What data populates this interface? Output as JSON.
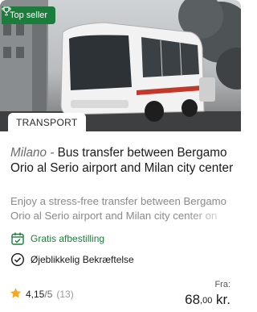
{
  "badge": {
    "label": "Top seller",
    "icon": "trophy-icon"
  },
  "category": "TRANSPORT",
  "listing": {
    "location": "Milano",
    "separator": " - ",
    "title": "Bus transfer between Bergamo Orio al Serio airport and Milan city center",
    "description": "Enjoy a stress-free transfer between Bergamo Orio al Serio airport and Milan city center on"
  },
  "features": [
    {
      "label": "Gratis afbestilling",
      "icon": "calendar-check-icon"
    },
    {
      "label": "Øjeblikkelig Bekræftelse",
      "icon": "check-circle-icon"
    }
  ],
  "rating": {
    "score": "4,15",
    "out_of": "/5",
    "count": "(13)"
  },
  "price": {
    "label": "Fra:",
    "whole": "68",
    "decimals": ",00",
    "currency": " kr."
  },
  "colors": {
    "accent": "#1b7c3c",
    "star": "#f5a623"
  }
}
